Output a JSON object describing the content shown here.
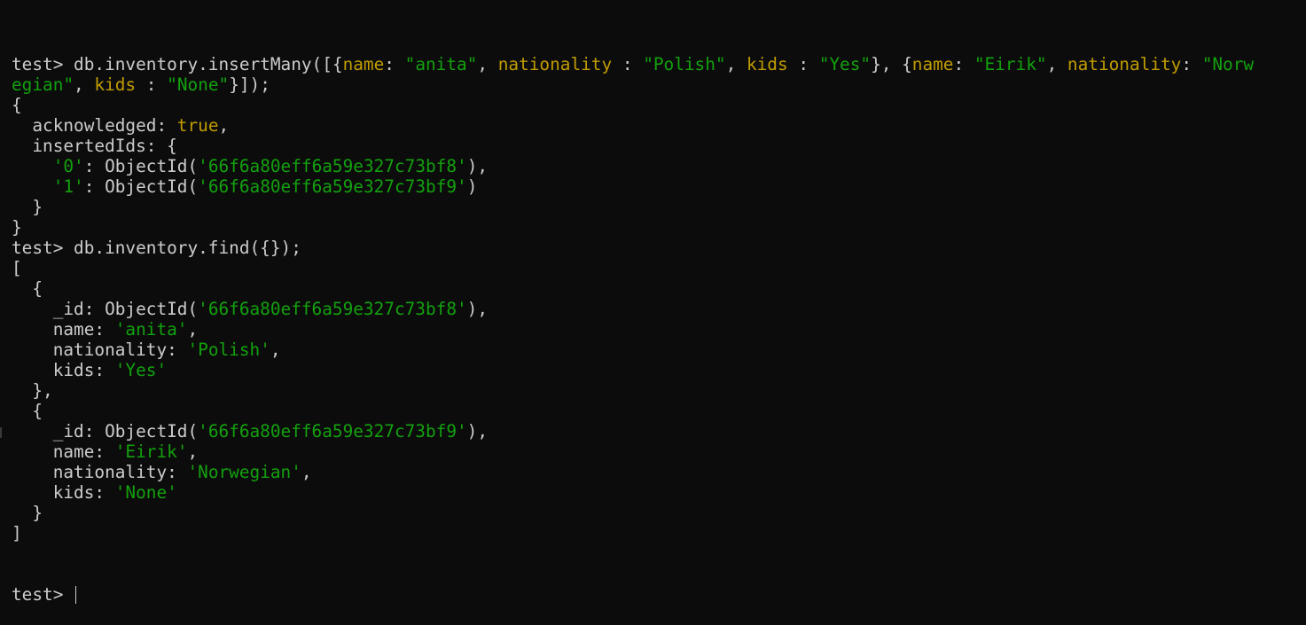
{
  "terminal": {
    "lines": [
      [
        {
          "t": "test> db.inventory.insertMany([{",
          "c": "plain"
        },
        {
          "t": "name",
          "c": "key"
        },
        {
          "t": ": ",
          "c": "plain"
        },
        {
          "t": "\"anita\"",
          "c": "str"
        },
        {
          "t": ", ",
          "c": "plain"
        },
        {
          "t": "nationality",
          "c": "key"
        },
        {
          "t": " : ",
          "c": "plain"
        },
        {
          "t": "\"Polish\"",
          "c": "str"
        },
        {
          "t": ", ",
          "c": "plain"
        },
        {
          "t": "kids",
          "c": "key"
        },
        {
          "t": " : ",
          "c": "plain"
        },
        {
          "t": "\"Yes\"",
          "c": "str"
        },
        {
          "t": "}, {",
          "c": "plain"
        },
        {
          "t": "name",
          "c": "key"
        },
        {
          "t": ": ",
          "c": "plain"
        },
        {
          "t": "\"Eirik\"",
          "c": "str"
        },
        {
          "t": ", ",
          "c": "plain"
        },
        {
          "t": "nationality",
          "c": "key"
        },
        {
          "t": ": ",
          "c": "plain"
        },
        {
          "t": "\"Norw",
          "c": "str"
        }
      ],
      [
        {
          "t": "egian\"",
          "c": "str"
        },
        {
          "t": ", ",
          "c": "plain"
        },
        {
          "t": "kids",
          "c": "key"
        },
        {
          "t": " : ",
          "c": "plain"
        },
        {
          "t": "\"None\"",
          "c": "str"
        },
        {
          "t": "}]);",
          "c": "plain"
        }
      ],
      [
        {
          "t": "{",
          "c": "plain"
        }
      ],
      [
        {
          "t": "  acknowledged: ",
          "c": "plain"
        },
        {
          "t": "true",
          "c": "kw"
        },
        {
          "t": ",",
          "c": "plain"
        }
      ],
      [
        {
          "t": "  insertedIds: {",
          "c": "plain"
        }
      ],
      [
        {
          "t": "    ",
          "c": "plain"
        },
        {
          "t": "'0'",
          "c": "str"
        },
        {
          "t": ": ObjectId(",
          "c": "plain"
        },
        {
          "t": "'66f6a80eff6a59e327c73bf8'",
          "c": "str"
        },
        {
          "t": "),",
          "c": "plain"
        }
      ],
      [
        {
          "t": "    ",
          "c": "plain"
        },
        {
          "t": "'1'",
          "c": "str"
        },
        {
          "t": ": ObjectId(",
          "c": "plain"
        },
        {
          "t": "'66f6a80eff6a59e327c73bf9'",
          "c": "str"
        },
        {
          "t": ")",
          "c": "plain"
        }
      ],
      [
        {
          "t": "  }",
          "c": "plain"
        }
      ],
      [
        {
          "t": "}",
          "c": "plain"
        }
      ],
      [
        {
          "t": "test> db.inventory.find({});",
          "c": "plain"
        }
      ],
      [
        {
          "t": "[",
          "c": "plain"
        }
      ],
      [
        {
          "t": "  {",
          "c": "plain"
        }
      ],
      [
        {
          "t": "    _id: ObjectId(",
          "c": "plain"
        },
        {
          "t": "'66f6a80eff6a59e327c73bf8'",
          "c": "str"
        },
        {
          "t": "),",
          "c": "plain"
        }
      ],
      [
        {
          "t": "    name: ",
          "c": "plain"
        },
        {
          "t": "'anita'",
          "c": "str"
        },
        {
          "t": ",",
          "c": "plain"
        }
      ],
      [
        {
          "t": "    nationality: ",
          "c": "plain"
        },
        {
          "t": "'Polish'",
          "c": "str"
        },
        {
          "t": ",",
          "c": "plain"
        }
      ],
      [
        {
          "t": "    kids: ",
          "c": "plain"
        },
        {
          "t": "'Yes'",
          "c": "str"
        }
      ],
      [
        {
          "t": "  },",
          "c": "plain"
        }
      ],
      [
        {
          "t": "  {",
          "c": "plain"
        }
      ],
      [
        {
          "t": "    _id: ObjectId(",
          "c": "plain"
        },
        {
          "t": "'66f6a80eff6a59e327c73bf9'",
          "c": "str"
        },
        {
          "t": "),",
          "c": "plain"
        }
      ],
      [
        {
          "t": "    name: ",
          "c": "plain"
        },
        {
          "t": "'Eirik'",
          "c": "str"
        },
        {
          "t": ",",
          "c": "plain"
        }
      ],
      [
        {
          "t": "    nationality: ",
          "c": "plain"
        },
        {
          "t": "'Norwegian'",
          "c": "str"
        },
        {
          "t": ",",
          "c": "plain"
        }
      ],
      [
        {
          "t": "    kids: ",
          "c": "plain"
        },
        {
          "t": "'None'",
          "c": "str"
        }
      ],
      [
        {
          "t": "  }",
          "c": "plain"
        }
      ],
      [
        {
          "t": "]",
          "c": "plain"
        }
      ]
    ],
    "prompt": "test> ",
    "input_value": ""
  },
  "colors": {
    "background": "#0c0c0c",
    "foreground": "#cccccc",
    "key": "#c19c00",
    "string": "#13a10e",
    "keyword": "#c19c00"
  }
}
